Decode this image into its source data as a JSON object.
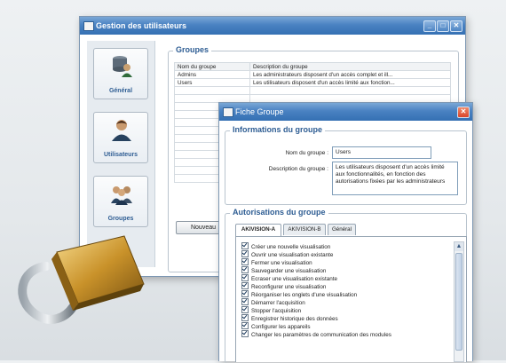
{
  "colors": {
    "accent": "#2e5d93",
    "titlebar": "#4a82c2",
    "close": "#d9452c"
  },
  "main_window": {
    "title": "Gestion des utilisateurs",
    "nav": [
      {
        "label": "Général",
        "icon": "database-users-icon"
      },
      {
        "label": "Utilisateurs",
        "icon": "user-icon"
      },
      {
        "label": "Groupes",
        "icon": "group-icon"
      }
    ],
    "groups_heading": "Groupes",
    "table": {
      "headers": [
        "Nom du groupe",
        "Description du groupe"
      ],
      "rows": [
        [
          "Admins",
          "Les administrateurs disposent d'un accès complet et ill..."
        ],
        [
          "Users",
          "Les utilisateurs disposent d'un accès limité aux fonction..."
        ]
      ]
    },
    "new_button": "Nouveau"
  },
  "dialog": {
    "title": "Fiche Groupe",
    "info_heading": "Informations du groupe",
    "name_label": "Nom du groupe :",
    "name_value": "Users",
    "desc_label": "Description du groupe :",
    "desc_value": "Les utilisateurs disposent d'un accès limité aux fonctionnalités, en fonction des autorisations fixées par les administrateurs",
    "perm_heading": "Autorisations du groupe",
    "tabs": [
      "AKIVISION-A",
      "AKIVISION-B",
      "Général"
    ],
    "permissions": [
      "Créer une nouvelle visualisation",
      "Ouvrir une visualisation existante",
      "Fermer une visualisation",
      "Sauvegarder une visualisation",
      "Ecraser une visualisation existante",
      "Reconfigurer une visualisation",
      "Réorganiser les onglets d'une visualisation",
      "Démarrer l'acquisition",
      "Stopper l'acquisition",
      "Enregistrer historique des données",
      "Configurer les appareils",
      "Changer les paramètres de communication des modules"
    ]
  }
}
